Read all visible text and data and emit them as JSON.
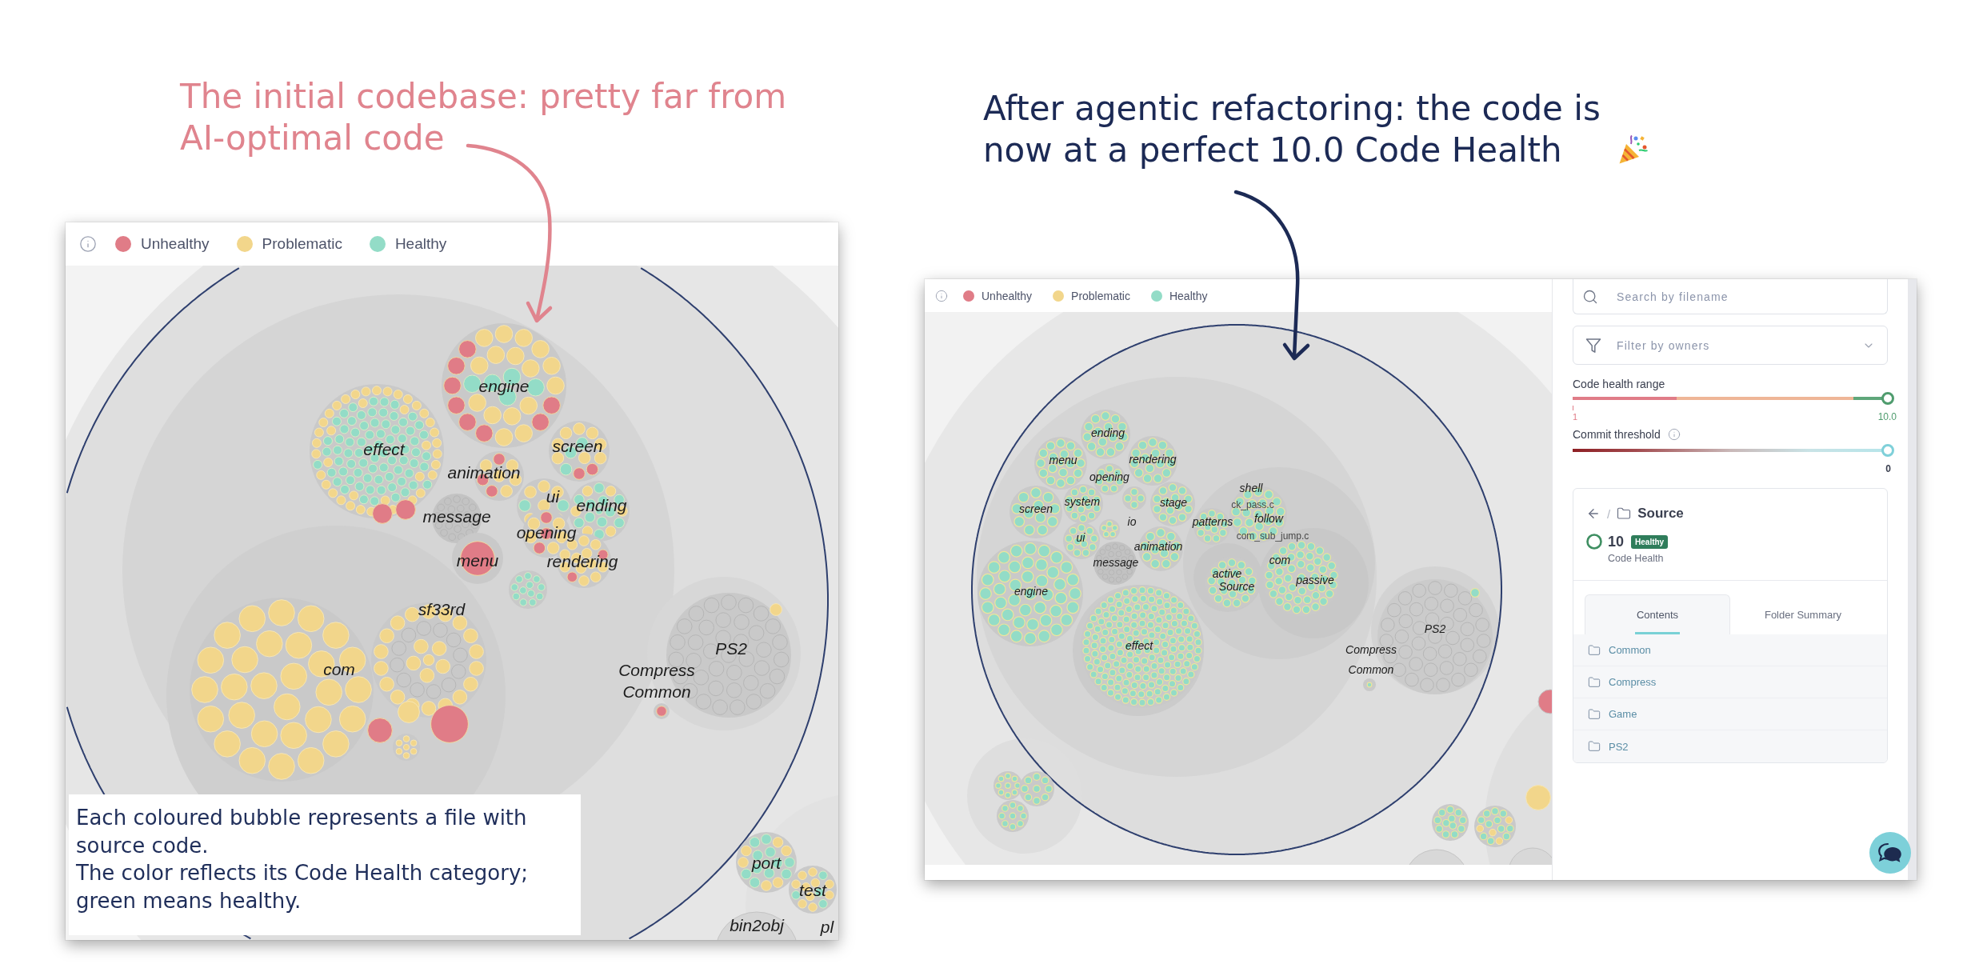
{
  "before": {
    "caption": "The initial codebase: pretty far from AI-optimal code",
    "legend": [
      {
        "label": "Unhealthy",
        "color": "#e07c87"
      },
      {
        "label": "Problematic",
        "color": "#f2d68b"
      },
      {
        "label": "Healthy",
        "color": "#93dcc7"
      }
    ],
    "map_labels": [
      {
        "text": "engine",
        "kind": "folder"
      },
      {
        "text": "effect",
        "kind": "folder"
      },
      {
        "text": "screen",
        "kind": "folder"
      },
      {
        "text": "animation",
        "kind": "folder"
      },
      {
        "text": "ui",
        "kind": "folder"
      },
      {
        "text": "message",
        "kind": "folder"
      },
      {
        "text": "ending",
        "kind": "folder"
      },
      {
        "text": "opening",
        "kind": "folder"
      },
      {
        "text": "menu",
        "kind": "folder"
      },
      {
        "text": "rendering",
        "kind": "folder"
      },
      {
        "text": "sf33rd",
        "kind": "folder"
      },
      {
        "text": "PS2",
        "kind": "folder"
      },
      {
        "text": "com",
        "kind": "folder"
      },
      {
        "text": "Compress",
        "kind": "folder"
      },
      {
        "text": "Common",
        "kind": "folder"
      },
      {
        "text": "port",
        "kind": "folder"
      },
      {
        "text": "test",
        "kind": "folder"
      },
      {
        "text": "bin2obj",
        "kind": "folder"
      },
      {
        "text": "pl",
        "kind": "folder"
      }
    ],
    "note": [
      "Each coloured bubble represents a file with source code.",
      "The color reflects its Code Health category; green means healthy."
    ]
  },
  "after": {
    "caption": "After agentic refactoring: the code is now at a perfect 10.0 Code Health",
    "legend": [
      {
        "label": "Unhealthy",
        "color": "#e07c87"
      },
      {
        "label": "Problematic",
        "color": "#f2d68b"
      },
      {
        "label": "Healthy",
        "color": "#93dcc7"
      }
    ],
    "map_labels": [
      {
        "text": "ending",
        "kind": "folder"
      },
      {
        "text": "menu",
        "kind": "folder"
      },
      {
        "text": "rendering",
        "kind": "folder"
      },
      {
        "text": "opening",
        "kind": "folder"
      },
      {
        "text": "shell",
        "kind": "folder"
      },
      {
        "text": "screen",
        "kind": "folder"
      },
      {
        "text": "system",
        "kind": "folder"
      },
      {
        "text": "stage",
        "kind": "folder"
      },
      {
        "text": "ck_pass.c",
        "kind": "file"
      },
      {
        "text": "io",
        "kind": "folder"
      },
      {
        "text": "patterns",
        "kind": "folder"
      },
      {
        "text": "follow",
        "kind": "folder"
      },
      {
        "text": "ui",
        "kind": "folder"
      },
      {
        "text": "animation",
        "kind": "folder"
      },
      {
        "text": "com_sub_jump.c",
        "kind": "file"
      },
      {
        "text": "message",
        "kind": "folder"
      },
      {
        "text": "com",
        "kind": "folder"
      },
      {
        "text": "active",
        "kind": "folder"
      },
      {
        "text": "engine",
        "kind": "folder"
      },
      {
        "text": "Source",
        "kind": "folder"
      },
      {
        "text": "passive",
        "kind": "folder"
      },
      {
        "text": "PS2",
        "kind": "folder"
      },
      {
        "text": "effect",
        "kind": "folder"
      },
      {
        "text": "Compress",
        "kind": "folder"
      },
      {
        "text": "Common",
        "kind": "folder"
      }
    ],
    "sidebar": {
      "search": {
        "placeholder": "Search by filename"
      },
      "owner_filter": {
        "placeholder": "Filter by owners"
      },
      "health_range": {
        "label": "Code health range",
        "min": "1",
        "max": "10.0",
        "level": 1
      },
      "commit_threshold": {
        "label": "Commit threshold",
        "value": "0",
        "level": 1
      },
      "folder": {
        "separator": "/",
        "name": "Source",
        "score": "10",
        "badge": "Healthy",
        "score_label": "Code Health"
      },
      "tabs": [
        {
          "label": "Contents",
          "selected": true
        },
        {
          "label": "Folder Summary",
          "selected": false
        }
      ],
      "items": [
        {
          "name": "Common"
        },
        {
          "name": "Compress"
        },
        {
          "name": "Game"
        },
        {
          "name": "PS2"
        }
      ]
    }
  }
}
